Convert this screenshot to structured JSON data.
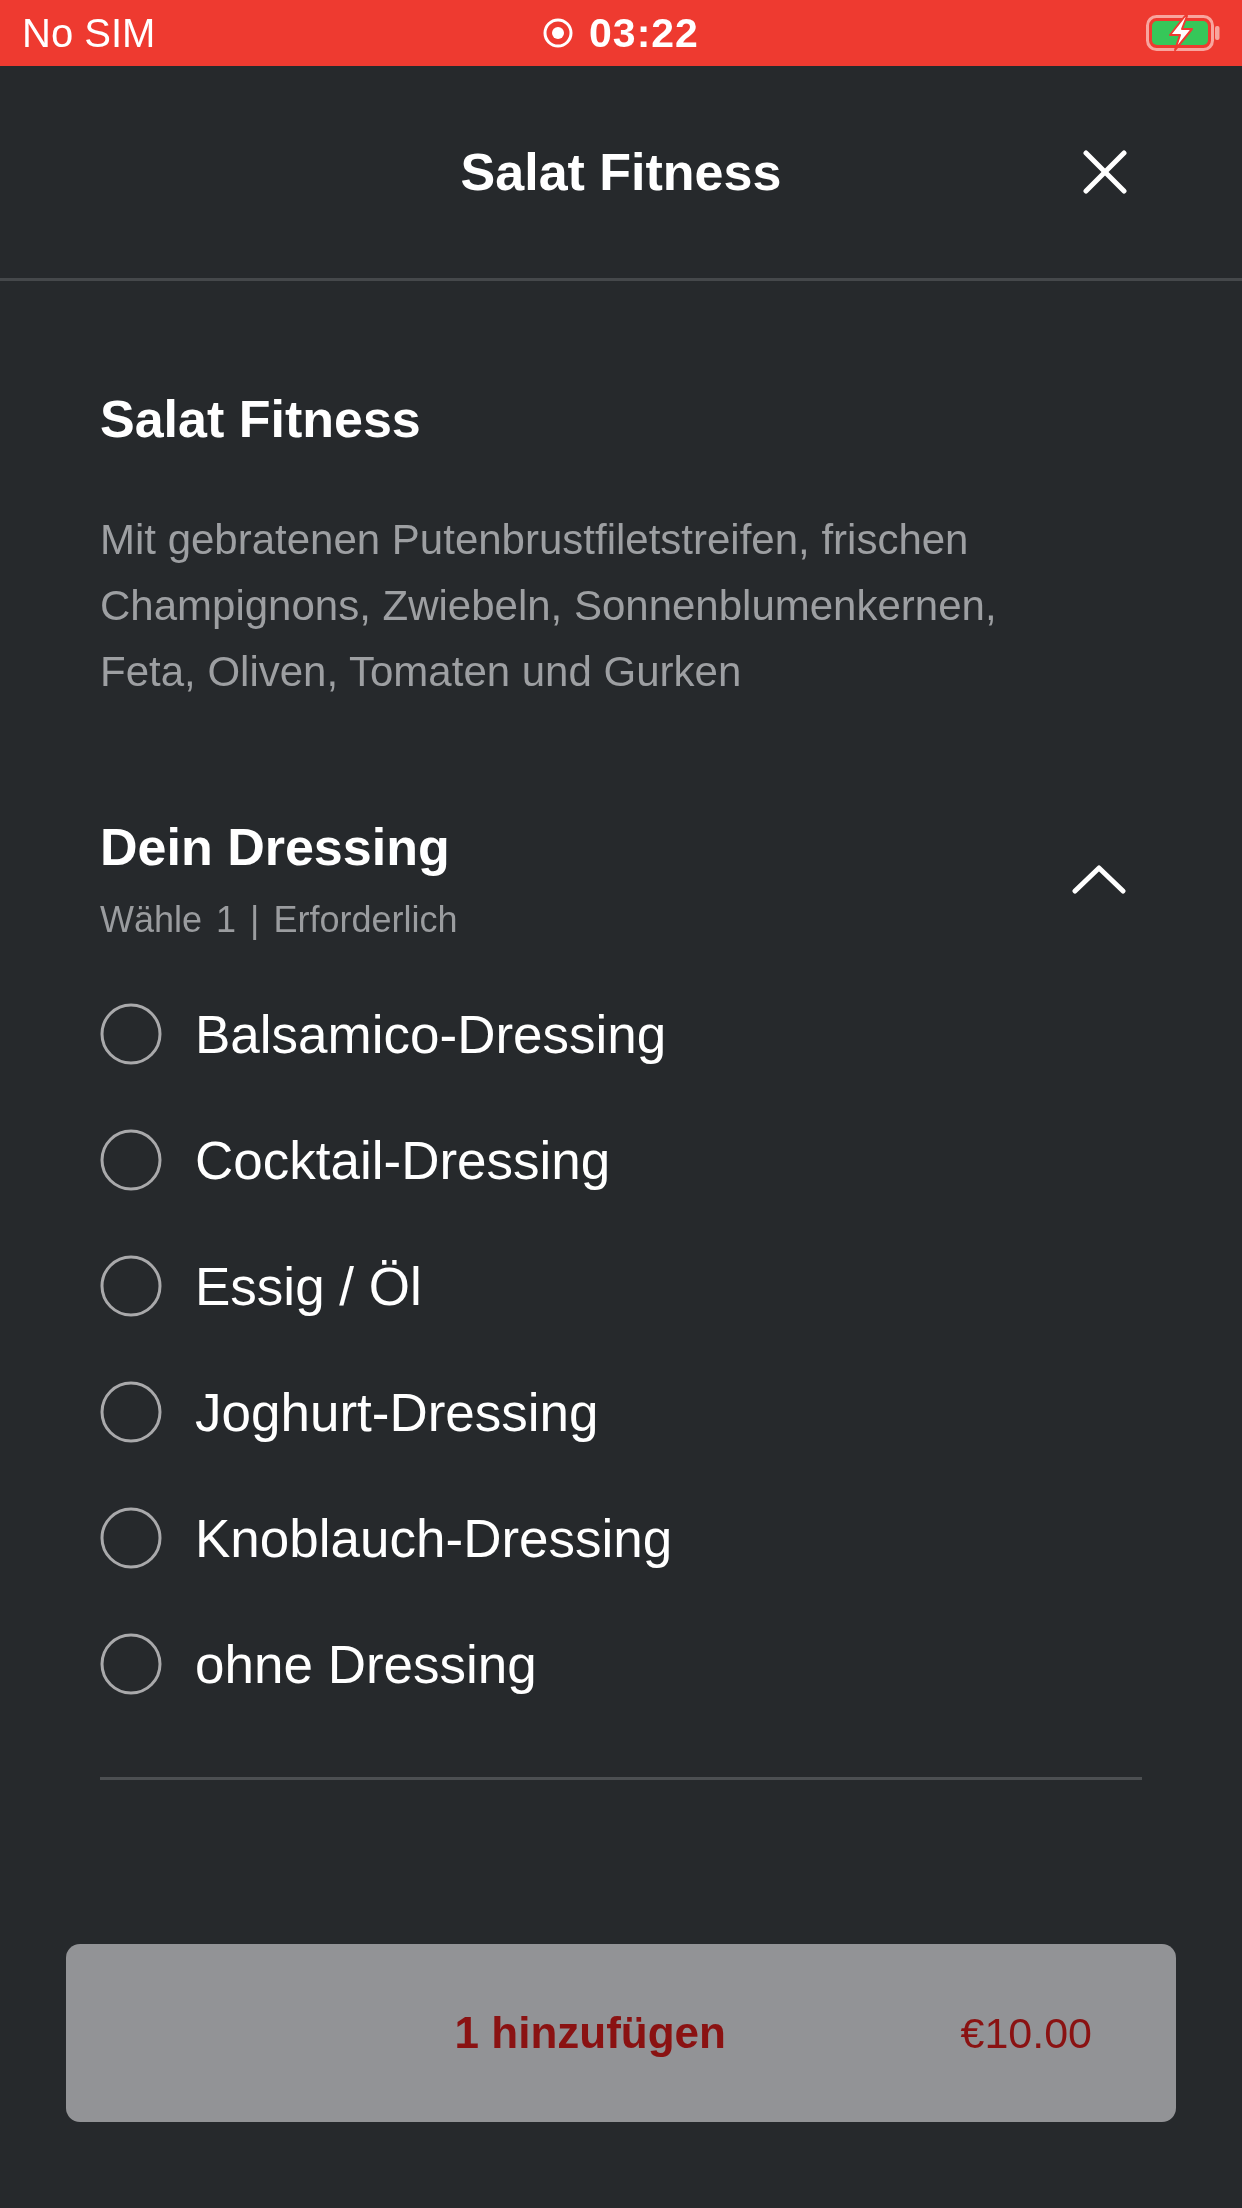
{
  "status_bar": {
    "carrier": "No SIM",
    "time": "03:22"
  },
  "header": {
    "title": "Salat Fitness"
  },
  "item": {
    "name": "Salat Fitness",
    "description": "Mit gebratenen Putenbrustfiletstreifen, frischen Champignons, Zwiebeln, Sonnenblumenkernen, Feta, Oliven, Tomaten und Gurken"
  },
  "option_group": {
    "title": "Dein Dressing",
    "subtitle": "Wähle 1 | Erforderlich",
    "expanded": true,
    "options": [
      {
        "label": "Balsamico-Dressing",
        "selected": false
      },
      {
        "label": "Cocktail-Dressing",
        "selected": false
      },
      {
        "label": "Essig / Öl",
        "selected": false
      },
      {
        "label": "Joghurt-Dressing",
        "selected": false
      },
      {
        "label": "Knoblauch-Dressing",
        "selected": false
      },
      {
        "label": "ohne Dressing",
        "selected": false
      }
    ]
  },
  "add_button": {
    "label": "1 hinzufügen",
    "price": "€10.00",
    "disabled": true
  }
}
